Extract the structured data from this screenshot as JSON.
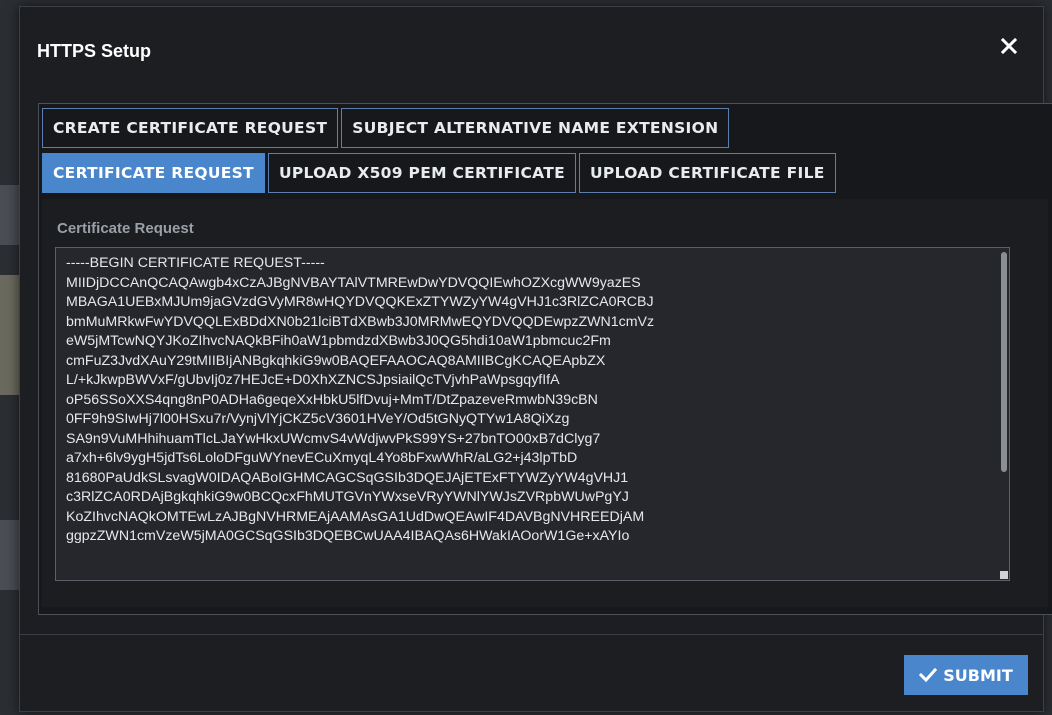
{
  "dialog": {
    "title": "HTTPS Setup",
    "close_icon": "close-icon"
  },
  "tabs_row1": [
    {
      "label": "CREATE CERTIFICATE REQUEST",
      "active": false
    },
    {
      "label": "SUBJECT ALTERNATIVE NAME EXTENSION",
      "active": false
    }
  ],
  "tabs_row2": [
    {
      "label": "CERTIFICATE REQUEST",
      "active": true
    },
    {
      "label": "UPLOAD X509 PEM CERTIFICATE",
      "active": false
    },
    {
      "label": "UPLOAD CERTIFICATE FILE",
      "active": false
    }
  ],
  "certificate": {
    "label": "Certificate Request",
    "value": "-----BEGIN CERTIFICATE REQUEST-----\nMIIDjDCCAnQCAQAwgb4xCzAJBgNVBAYTAlVTMREwDwYDVQQIEwhOZXcgWW9yazES\nMBAGA1UEBxMJUm9jaGVzdGVyMR8wHQYDVQQKExZTYWZyYW4gVHJ1c3RlZCA0RCBJ\nbmMuMRkwFwYDVQQLExBDdXN0b21lciBTdXBwb3J0MRMwEQYDVQQDEwpzZWN1cmVz\neW5jMTcwNQYJKoZIhvcNAQkBFih0aW1pbmdzdXBwb3J0QG5hdi10aW1pbmcuc2Fm\ncmFuZ3JvdXAuY29tMIIBIjANBgkqhkiG9w0BAQEFAAOCAQ8AMIIBCgKCAQEApbZX\nL/+kJkwpBWVxF/gUbvIj0z7HEJcE+D0XhXZNCSJpsiailQcTVjvhPaWpsgqyfIfA\noP56SSoXXS4qng8nP0ADHa6geqeXxHbkU5lfDvuj+MmT/DtZpazeveRmwbN39cBN\n0FF9h9SIwHj7l00HSxu7r/VynjVlYjCKZ5cV3601HVeY/Od5tGNyQTYw1A8QiXzg\nSA9n9VuMHhihuamTlcLJaYwHkxUWcmvS4vWdjwvPkS99YS+27bnTO00xB7dClyg7\na7xh+6lv9ygH5jdTs6LoloDFguWYnevECuXmyqL4Yo8bFxwWhR/aLG2+j43lpTbD\n81680PaUdkSLsvagW0IDAQABoIGHMCAGCSqGSIb3DQEJAjETExFTYWZyYW4gVHJ1\nc3RlZCA0RDAjBgkqhkiG9w0BCQcxFhMUTGVnYWxseVRyYWNlYWJsZVRpbWUwPgYJ\nKoZIhvcNAQkOMTEwLzAJBgNVHRMEAjAAMAsGA1UdDwQEAwIF4DAVBgNVHREEDjAM\nggpzZWN1cmVzeW5jMA0GCSqGSIb3DQEBCwUAA4IBAQAs6HWakIAOorW1Ge+xAYIo"
  },
  "footer": {
    "submit_label": "SUBMIT",
    "submit_icon": "checkmark-icon"
  }
}
